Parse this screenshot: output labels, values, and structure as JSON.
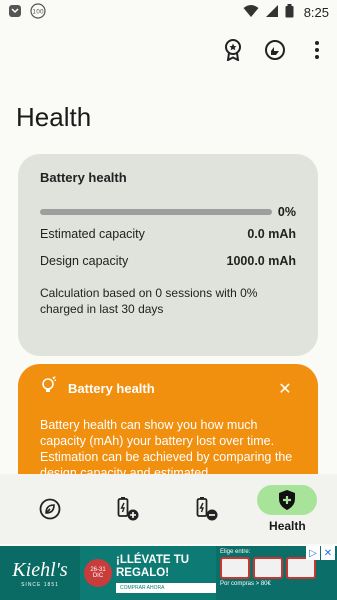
{
  "status": {
    "time": "8:25",
    "badge": "100"
  },
  "page": {
    "title": "Health"
  },
  "battery_card": {
    "title": "Battery health",
    "progress_percent": 0,
    "progress_label": "0%",
    "estimated_capacity_label": "Estimated capacity",
    "estimated_capacity_value": "0.0 mAh",
    "design_capacity_label": "Design capacity",
    "design_capacity_value": "1000.0 mAh",
    "note": "Calculation based on 0 sessions with 0% charged in last 30 days"
  },
  "tip_card": {
    "title": "Battery health",
    "body": "Battery health can show you how much capacity (mAh) your battery lost over time. Estimation can be achieved by comparing the design capacity and estimated"
  },
  "bottom_nav": {
    "active_label": "Health"
  },
  "ad": {
    "brand": "Kiehl's",
    "since": "SINCE 1851",
    "date_top": "26-31",
    "date_bottom": "DIC",
    "headline": "¡LLÉVATE TU REGALO!",
    "cta": "COMPRAR AHORA",
    "right_top": "Elige entre:",
    "right_bottom": "Por compras > 80€"
  },
  "colors": {
    "card_bg": "#dfe3db",
    "tip_bg": "#f18f0f",
    "nav_active": "#a8e39a"
  }
}
